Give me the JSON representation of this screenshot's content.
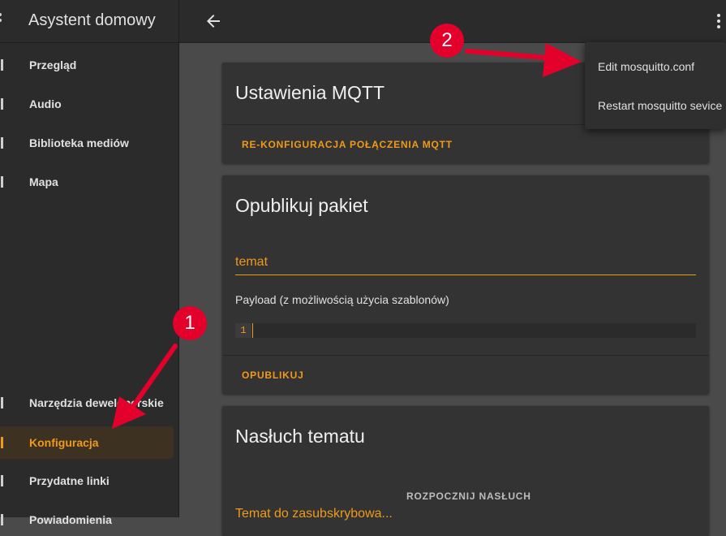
{
  "sidebar": {
    "title": "Asystent domowy",
    "items": [
      {
        "label": "Przegląd"
      },
      {
        "label": "Audio"
      },
      {
        "label": "Biblioteka mediów"
      },
      {
        "label": "Mapa"
      },
      {
        "label": "Narzędzia deweloperskie"
      },
      {
        "label": "Konfiguracja",
        "active": true
      },
      {
        "label": "Przydatne linki"
      },
      {
        "label": "Powiadomienia"
      }
    ]
  },
  "cards": {
    "mqtt": {
      "title": "Ustawienia MQTT",
      "action": "RE-KONFIGURACJA POŁĄCZENIA MQTT"
    },
    "publish": {
      "title": "Opublikuj pakiet",
      "topic_value": "temat",
      "payload_label": "Payload (z możliwością użycia szablonów)",
      "line_number": "1",
      "action": "OPUBLIKUJ"
    },
    "listen": {
      "title": "Nasłuch tematu",
      "action": "ROZPOCZNIJ NASŁUCH",
      "topic_placeholder": "Temat do zasubskrybowa..."
    }
  },
  "overflow_menu": {
    "items": [
      {
        "label": "Edit mosquitto.conf"
      },
      {
        "label": "Restart mosquitto sevice"
      }
    ]
  },
  "annotations": [
    {
      "number": "1"
    },
    {
      "number": "2"
    }
  ],
  "colors": {
    "accent": "#f09a1a",
    "badge": "#e3002b"
  }
}
